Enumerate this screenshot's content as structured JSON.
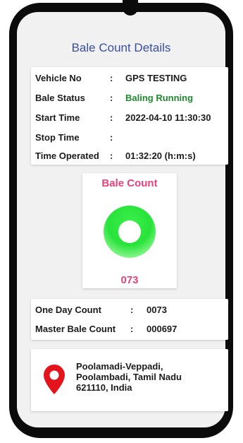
{
  "page": {
    "title": "Bale Count Details"
  },
  "details": {
    "rows": [
      {
        "label": "Vehicle No",
        "value": "GPS TESTING"
      },
      {
        "label": "Bale Status",
        "value": "Baling Running"
      },
      {
        "label": "Start Time",
        "value": "2022-04-10 11:30:30"
      },
      {
        "label": "Stop Time",
        "value": ""
      },
      {
        "label": "Time Operated",
        "value": "01:32:20 (h:m:s)"
      }
    ],
    "separator": ":"
  },
  "bale": {
    "title": "Bale Count",
    "value": "073"
  },
  "counts": {
    "rows": [
      {
        "label": "One Day Count",
        "value": "0073"
      },
      {
        "label": "Master Bale Count",
        "value": "000697"
      }
    ]
  },
  "location": {
    "lines": [
      "Poolamadi-Veppadi,",
      "Poolambadi, Tamil Nadu",
      "621110, India"
    ],
    "icon": "location-pin-icon"
  },
  "colors": {
    "title": "#3a4fa1",
    "status_running": "#1e8a2e",
    "accent_pink": "#e8417c",
    "ring_green": "#28e33a",
    "pin_red": "#e3141b"
  }
}
